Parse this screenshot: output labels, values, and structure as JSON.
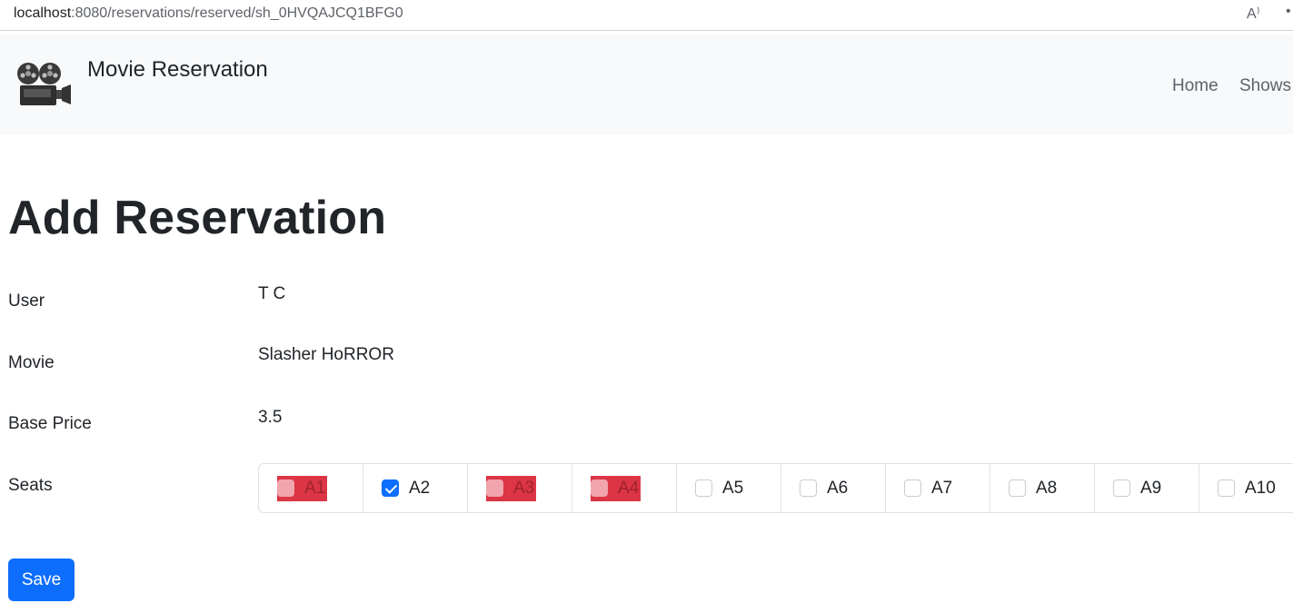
{
  "browser": {
    "url_host": "localhost",
    "url_rest": ":8080/reservations/reserved/sh_0HVQAJCQ1BFG0",
    "read_aloud_glyph": "A⁾"
  },
  "navbar": {
    "brand": "Movie Reservation",
    "links": [
      {
        "label": "Home"
      },
      {
        "label": "Shows"
      }
    ]
  },
  "page": {
    "title": "Add Reservation"
  },
  "form": {
    "user_label": "User",
    "user_value": "T C",
    "movie_label": "Movie",
    "movie_value": "Slasher HoRROR",
    "price_label": "Base Price",
    "price_value": "3.5",
    "seats_label": "Seats",
    "seats": [
      {
        "label": "A1",
        "state": "reserved"
      },
      {
        "label": "A2",
        "state": "checked"
      },
      {
        "label": "A3",
        "state": "reserved"
      },
      {
        "label": "A4",
        "state": "reserved"
      },
      {
        "label": "A5",
        "state": "available"
      },
      {
        "label": "A6",
        "state": "available"
      },
      {
        "label": "A7",
        "state": "available"
      },
      {
        "label": "A8",
        "state": "available"
      },
      {
        "label": "A9",
        "state": "available"
      },
      {
        "label": "A10",
        "state": "available"
      }
    ],
    "save_label": "Save"
  },
  "colors": {
    "primary": "#0d6efd",
    "reserved": "#dc3545",
    "navbar_bg": "#f8f9fa"
  }
}
